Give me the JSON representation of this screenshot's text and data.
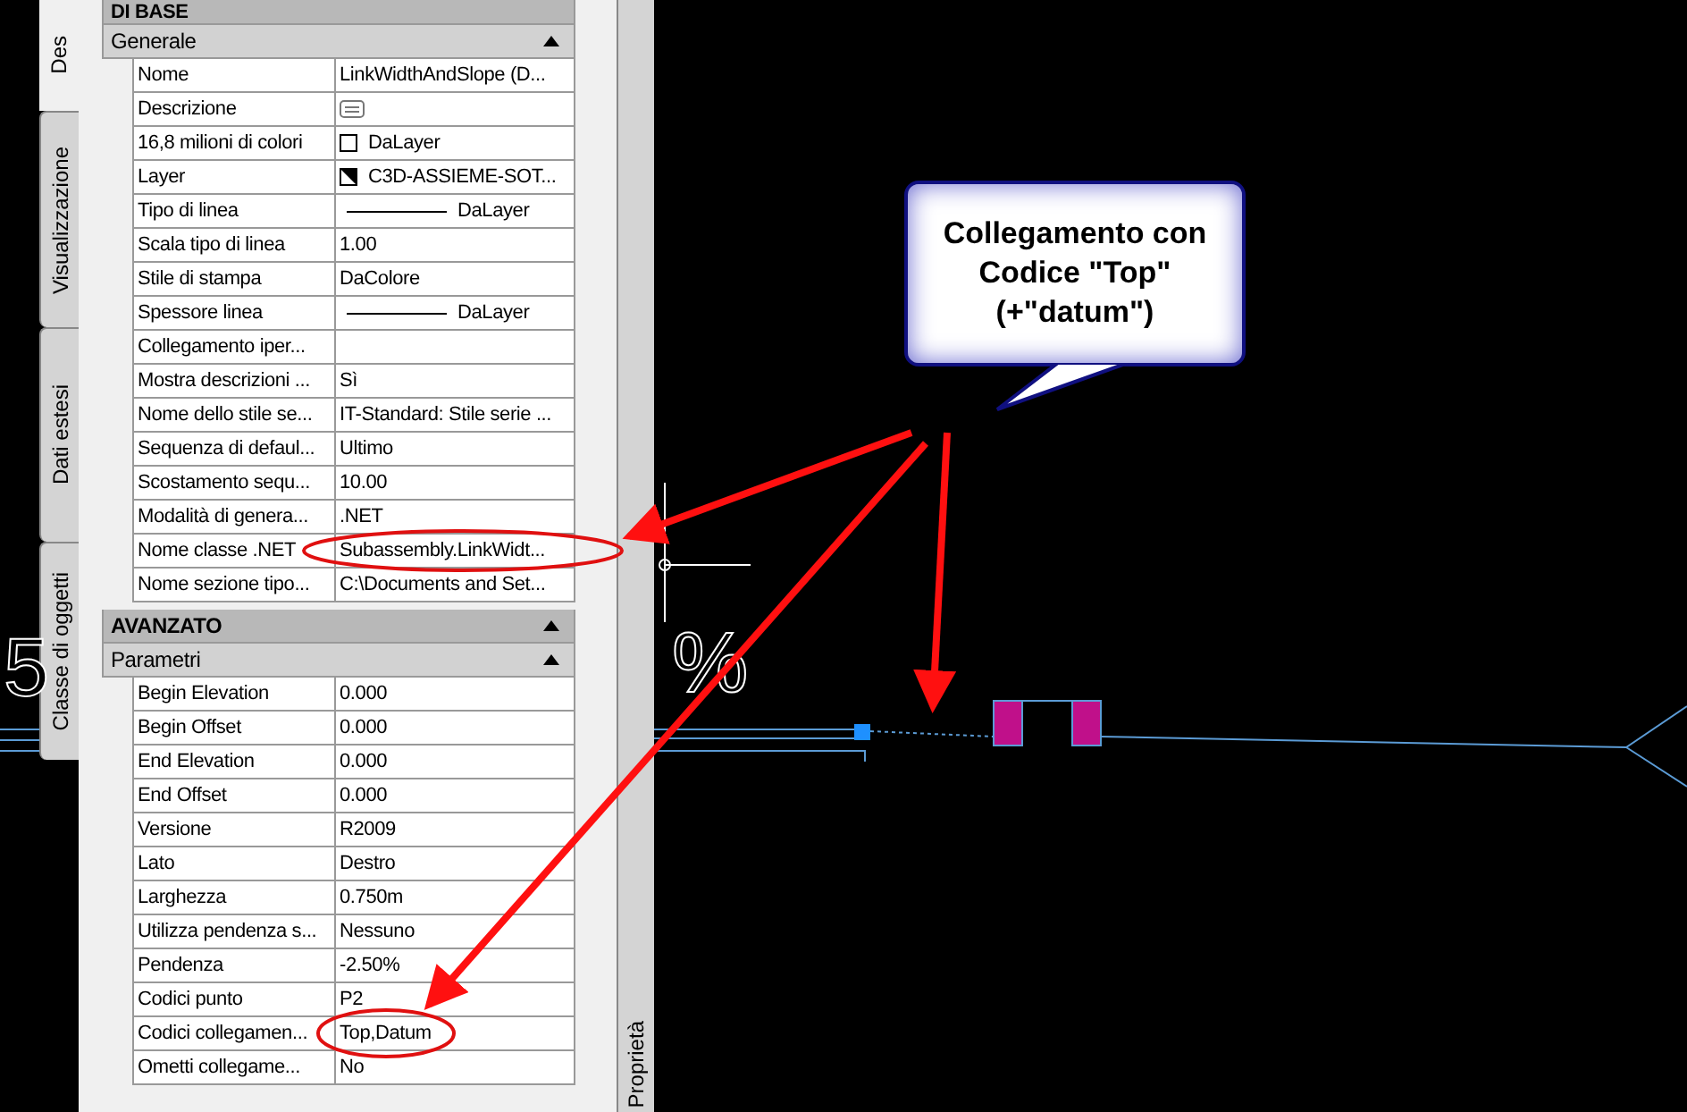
{
  "tabs": [
    {
      "label": "Des",
      "selected": true
    },
    {
      "label": "Visualizzazione",
      "selected": false
    },
    {
      "label": "Dati estesi",
      "selected": false
    },
    {
      "label": "Classe di oggetti",
      "selected": false
    }
  ],
  "panel": {
    "top_header": "DI BASE",
    "sections": [
      {
        "title": "Generale",
        "kind": "sub",
        "expanded": true,
        "rows": [
          {
            "label": "Nome",
            "value": "LinkWidthAndSlope (D...",
            "kind": "text"
          },
          {
            "label": "Descrizione",
            "kind": "description"
          },
          {
            "label": "16,8 milioni di colori",
            "value": "DaLayer",
            "kind": "color"
          },
          {
            "label": "Layer",
            "value": "C3D-ASSIEME-SOT...",
            "kind": "layer"
          },
          {
            "label": "Tipo di linea",
            "value": "DaLayer",
            "kind": "line"
          },
          {
            "label": "Scala tipo di linea",
            "value": "1.00",
            "kind": "text"
          },
          {
            "label": "Stile di stampa",
            "value": "DaColore",
            "kind": "text"
          },
          {
            "label": "Spessore linea",
            "value": "DaLayer",
            "kind": "line"
          },
          {
            "label": "Collegamento iper...",
            "kind": "empty"
          },
          {
            "label": "Mostra descrizioni ...",
            "value": "Sì",
            "kind": "text"
          },
          {
            "label": "Nome dello stile se...",
            "value": "IT-Standard: Stile serie ...",
            "kind": "text"
          },
          {
            "label": "Sequenza di defaul...",
            "value": "Ultimo",
            "kind": "text"
          },
          {
            "label": "Scostamento sequ...",
            "value": "10.00",
            "kind": "text"
          },
          {
            "label": "Modalità di genera...",
            "value": ".NET",
            "kind": "text"
          },
          {
            "label": "Nome classe .NET",
            "value": "Subassembly.LinkWidt...",
            "kind": "text"
          },
          {
            "label": "Nome sezione tipo...",
            "value": "C:\\Documents and Set...",
            "kind": "text"
          }
        ]
      },
      {
        "title": "AVANZATO",
        "kind": "main",
        "expanded": true
      },
      {
        "title": "Parametri",
        "kind": "sub",
        "expanded": true,
        "rows": [
          {
            "label": "Begin Elevation",
            "value": "0.000",
            "kind": "text"
          },
          {
            "label": "Begin Offset",
            "value": "0.000",
            "kind": "text"
          },
          {
            "label": "End Elevation",
            "value": "0.000",
            "kind": "text"
          },
          {
            "label": "End Offset",
            "value": "0.000",
            "kind": "text"
          },
          {
            "label": "Versione",
            "value": "R2009",
            "kind": "text"
          },
          {
            "label": "Lato",
            "value": "Destro",
            "kind": "text"
          },
          {
            "label": "Larghezza",
            "value": "0.750m",
            "kind": "text"
          },
          {
            "label": "Utilizza pendenza s...",
            "value": "Nessuno",
            "kind": "text"
          },
          {
            "label": "Pendenza",
            "value": "-2.50%",
            "kind": "text"
          },
          {
            "label": "Codici punto",
            "value": "P2",
            "kind": "text"
          },
          {
            "label": "Codici collegamen...",
            "value": "Top,Datum",
            "kind": "text"
          },
          {
            "label": "Ometti collegame...",
            "value": "No",
            "kind": "text"
          }
        ]
      }
    ]
  },
  "side_tab": {
    "label": "Proprietà"
  },
  "drawing_texts": [
    "5",
    "%"
  ],
  "callout": {
    "lines": [
      "Collegamento con",
      "Codice \"Top\"",
      "(+\"datum\")"
    ]
  }
}
